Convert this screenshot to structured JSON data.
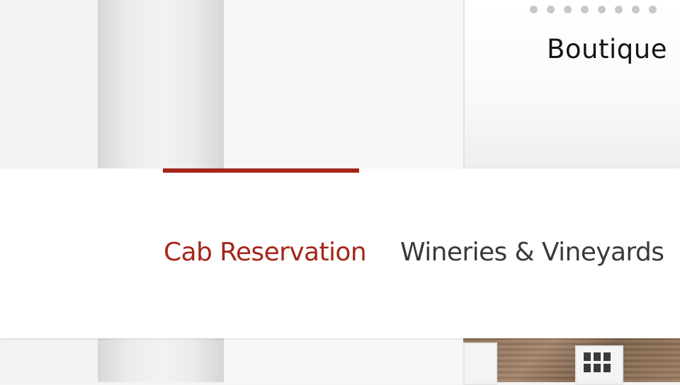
{
  "card": {
    "title": "Boutique",
    "dot_count": 8
  },
  "nav": {
    "tabs": [
      {
        "label": "Cab Reservation",
        "active": true
      },
      {
        "label": "Wineries & Vineyards",
        "active": false
      }
    ],
    "active_color": "#a3261a",
    "inactive_color": "#3a3a3a"
  }
}
